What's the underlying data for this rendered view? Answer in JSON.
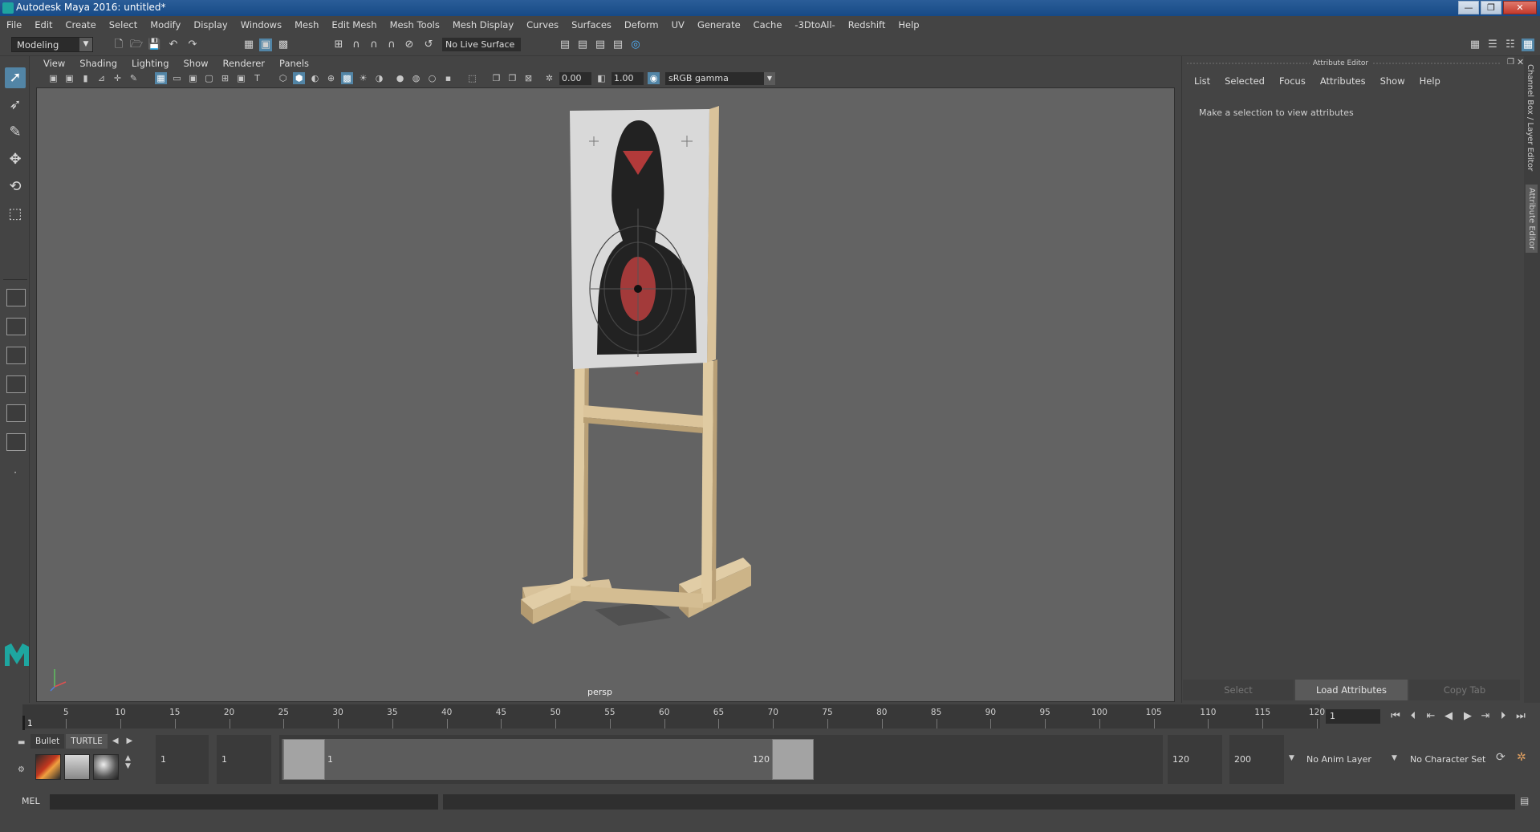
{
  "window": {
    "title": "Autodesk Maya 2016: untitled*",
    "minimize": "—",
    "maximize": "❐",
    "close": "✕"
  },
  "menubar": [
    "File",
    "Edit",
    "Create",
    "Select",
    "Modify",
    "Display",
    "Windows",
    "Mesh",
    "Edit Mesh",
    "Mesh Tools",
    "Mesh Display",
    "Curves",
    "Surfaces",
    "Deform",
    "UV",
    "Generate",
    "Cache",
    "-3DtoAll-",
    "Redshift",
    "Help"
  ],
  "statusline": {
    "mode": "Modeling",
    "live_surface": "No Live Surface"
  },
  "panel": {
    "menu": [
      "View",
      "Shading",
      "Lighting",
      "Show",
      "Renderer",
      "Panels"
    ],
    "exposure": "0.00",
    "gamma_value": "1.00",
    "color_space": "sRGB gamma",
    "camera_label": "persp"
  },
  "attribute_editor": {
    "title": "Attribute Editor",
    "menu": [
      "List",
      "Selected",
      "Focus",
      "Attributes",
      "Show",
      "Help"
    ],
    "message": "Make a selection to view attributes",
    "buttons": {
      "select": "Select",
      "load": "Load Attributes",
      "copy": "Copy Tab"
    }
  },
  "side_tabs": {
    "channel_box": "Channel Box / Layer Editor",
    "attribute_editor": "Attribute Editor"
  },
  "timeline": {
    "ticks": [
      "5",
      "10",
      "15",
      "20",
      "25",
      "30",
      "35",
      "40",
      "45",
      "50",
      "55",
      "60",
      "65",
      "70",
      "75",
      "80",
      "85",
      "90",
      "95",
      "100",
      "105",
      "110",
      "115",
      "120"
    ],
    "current_frame_label": "1",
    "current_frame_field": "1",
    "range_start": 1,
    "range_end": 120
  },
  "range": {
    "anim_start": "1",
    "playback_start": "1",
    "slider_start": "1",
    "slider_end": "120",
    "playback_end": "120",
    "anim_end": "200",
    "anim_layer": "No Anim Layer",
    "character_set": "No Character Set"
  },
  "shelf": {
    "tabs": [
      "Bullet",
      "TURTLE"
    ]
  },
  "commandline": {
    "label": "MEL"
  }
}
